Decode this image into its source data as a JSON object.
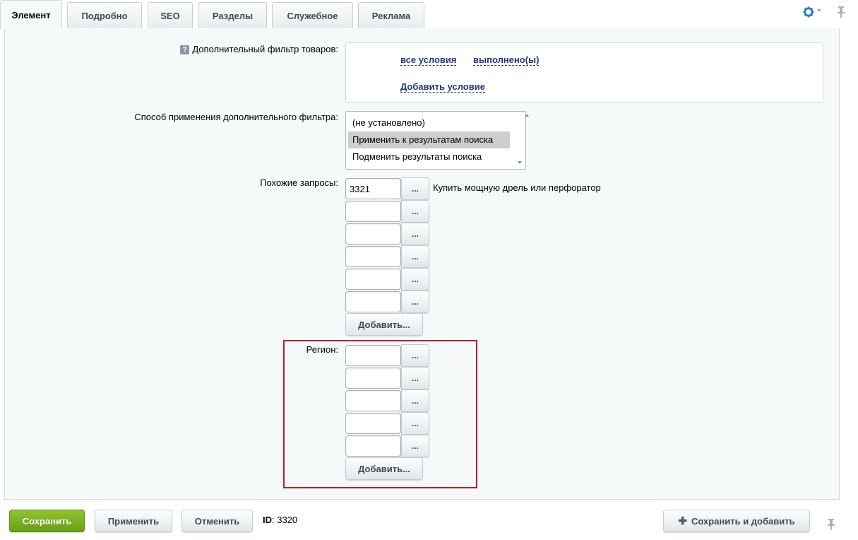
{
  "tabs": [
    {
      "label": "Элемент",
      "active": true
    },
    {
      "label": "Подробно",
      "active": false
    },
    {
      "label": "SEO",
      "active": false
    },
    {
      "label": "Разделы",
      "active": false
    },
    {
      "label": "Служебное",
      "active": false
    },
    {
      "label": "Реклама",
      "active": false
    }
  ],
  "icons": {
    "settings": "gear-icon",
    "pin": "pin-icon",
    "help": "help-icon",
    "add": "plus-icon"
  },
  "colors": {
    "accent_green": "#7ab31f",
    "link": "#25357b",
    "highlight": "#b0252a",
    "panel_bg": "#f5f9f9"
  },
  "filter": {
    "label": "Дополнительный фильтр товаров:",
    "help_glyph": "?",
    "all_conditions": "все условия",
    "fulfilled": "выполнено(ы)",
    "add_condition": "Добавить условие"
  },
  "apply_method": {
    "label": "Способ применения дополнительного фильтра:",
    "options": [
      "(не установлено)",
      "Применить к результатам поиска",
      "Подменить результаты поиска"
    ],
    "selected": "Применить к результатам поиска"
  },
  "similar": {
    "label": "Похожие запросы:",
    "values": [
      "3321",
      "",
      "",
      "",
      "",
      ""
    ],
    "first_text": "Купить мощную дрель или перфоратор",
    "browse_label": "...",
    "add_label": "Добавить..."
  },
  "region": {
    "label": "Регион:",
    "values": [
      "",
      "",
      "",
      "",
      ""
    ],
    "browse_label": "...",
    "add_label": "Добавить..."
  },
  "footer": {
    "save": "Сохранить",
    "apply": "Применить",
    "cancel": "Отменить",
    "id_label": "ID",
    "id_value": ": 3320",
    "save_add": "Сохранить и добавить"
  }
}
